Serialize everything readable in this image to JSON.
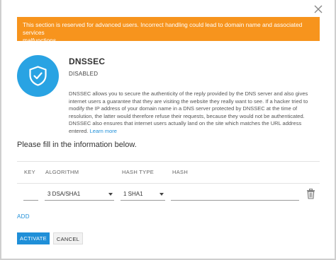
{
  "warning": {
    "line1": "This section is reserved for advanced users. Incorrect handling could lead to domain name and associated services",
    "line2": "malfunctions."
  },
  "icons": {
    "close": "close-icon",
    "shield": "shield-check-icon",
    "delete": "trash-icon",
    "dropdown": "chevron-down-icon"
  },
  "colors": {
    "warning_bg": "#f7941d",
    "accent": "#1f8fd8",
    "shield_circle": "#29a3e3"
  },
  "dnssec": {
    "title": "DNSSEC",
    "status": "DISABLED",
    "description": "DNSSEC allows you to secure the authenticity of the reply provided by the DNS server and also gives internet users a guarantee that they are visiting the website they really want to see. If a hacker tried to modify the IP address of your domain name in a DNS server protected by DNSSEC at the time of resolution, the latter would therefore refuse their requests, because they would not be authenticated. DNSSEC also ensures that internet users actually land on the site which matches the URL address entered.",
    "learn_more": "Learn more"
  },
  "form": {
    "heading": "Please fill in the information below.",
    "columns": {
      "key": "KEY",
      "algorithm": "ALGORITHM",
      "hash_type": "HASH TYPE",
      "hash": "HASH"
    },
    "row": {
      "key": "",
      "algorithm": "3 DSA/SHA1",
      "hash_type": "1 SHA1",
      "hash": ""
    },
    "add_label": "ADD"
  },
  "buttons": {
    "activate": "ACTIVATE",
    "cancel": "CANCEL"
  }
}
